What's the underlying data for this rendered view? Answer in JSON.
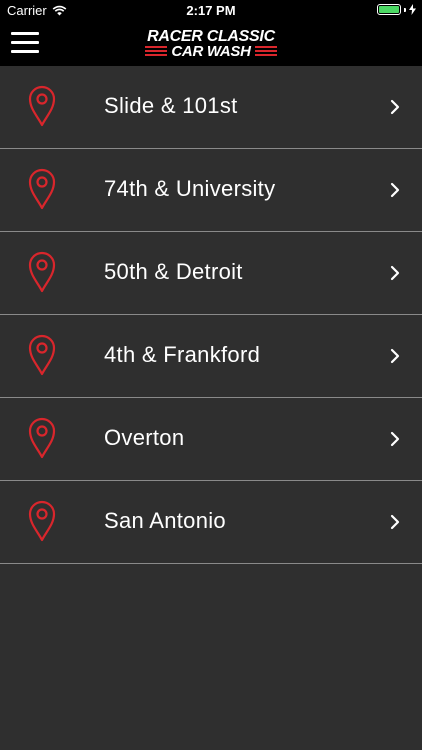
{
  "status_bar": {
    "carrier": "Carrier",
    "time": "2:17 PM",
    "battery_level": 1.0,
    "battery_color": "#4cd964"
  },
  "header": {
    "menu_icon": "hamburger-menu-icon",
    "logo": {
      "line1": "RACER CLASSIC",
      "line2": "CAR WASH"
    }
  },
  "locations": [
    {
      "name": "Slide & 101st",
      "icon": "map-pin-icon"
    },
    {
      "name": "74th & University",
      "icon": "map-pin-icon"
    },
    {
      "name": "50th & Detroit",
      "icon": "map-pin-icon"
    },
    {
      "name": "4th & Frankford",
      "icon": "map-pin-icon"
    },
    {
      "name": "Overton",
      "icon": "map-pin-icon"
    },
    {
      "name": "San Antonio",
      "icon": "map-pin-icon"
    }
  ],
  "colors": {
    "background": "#2f2f2f",
    "header": "#000000",
    "accent_red": "#d9262c",
    "divider": "#8a8a8a"
  }
}
